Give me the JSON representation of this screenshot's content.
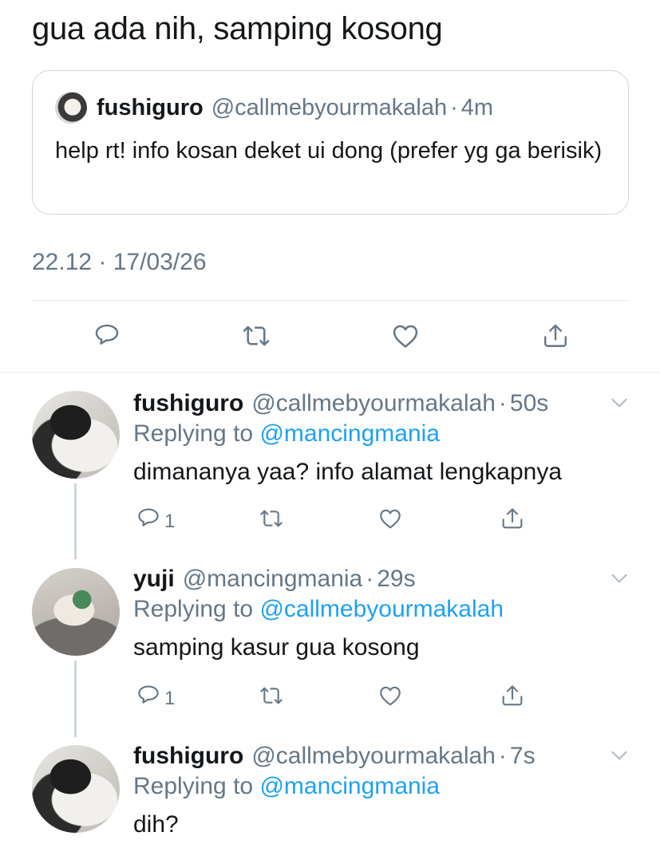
{
  "tweet": {
    "text": "gua ada nih, samping kosong",
    "timestamp": "22.12 · 17/03/26"
  },
  "quoted": {
    "name": "fushiguro",
    "handle": "@callmebyourmakalah",
    "separator": "·",
    "time": "4m",
    "text": "help rt! info kosan deket ui dong (prefer yg ga berisik)"
  },
  "main_actions": {
    "reply_icon": "reply-icon",
    "retweet_icon": "retweet-icon",
    "like_icon": "heart-icon",
    "share_icon": "share-icon"
  },
  "replies": [
    {
      "name": "fushiguro",
      "handle": "@callmebyourmakalah",
      "separator": "·",
      "time": "50s",
      "replying_prefix": "Replying to ",
      "replying_to": "@mancingmania",
      "text": "dimananya yaa? info alamat lengkapnya",
      "reply_count": "1"
    },
    {
      "name": "yuji",
      "handle": "@mancingmania",
      "separator": "·",
      "time": "29s",
      "replying_prefix": "Replying to ",
      "replying_to": "@callmebyourmakalah",
      "text": "samping kasur gua kosong",
      "reply_count": "1"
    },
    {
      "name": "fushiguro",
      "handle": "@callmebyourmakalah",
      "separator": "·",
      "time": "7s",
      "replying_prefix": "Replying to ",
      "replying_to": "@mancingmania",
      "text": "dih?",
      "reply_count": ""
    }
  ],
  "colors": {
    "text": "#14171a",
    "secondary": "#657786",
    "link": "#1da1f2",
    "border": "#ccd6dd"
  }
}
